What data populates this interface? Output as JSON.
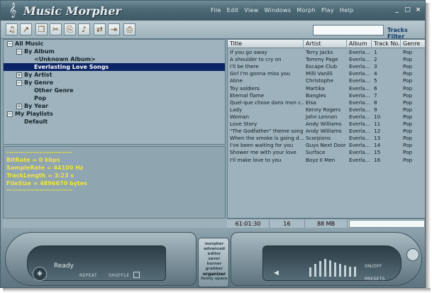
{
  "window": {
    "title": "Music Morpher",
    "logo_glyph": "𝄞",
    "controls": [
      "_",
      "□",
      "×"
    ]
  },
  "menu": [
    "File",
    "Edit",
    "View",
    "Windows",
    "Morph",
    "Play",
    "Help"
  ],
  "toolbar": {
    "buttons": [
      "add-music-icon",
      "add-folder-icon",
      "copy-icon",
      "cut-icon",
      "paste-icon",
      "music-note-icon",
      "move-icon",
      "export-icon",
      "print-icon"
    ],
    "filter_label": "Tracks Filter",
    "filter_value": ""
  },
  "tree": {
    "all_music": "All Music",
    "by_album": "By Album",
    "unknown_album": "<Unknown Album>",
    "everlasting": "Everlasting Love Songs",
    "by_artist": "By Artist",
    "by_genre": "By Genre",
    "other_genre": "Other Genre",
    "pop": "Pop",
    "by_year": "By Year",
    "my_playlists": "My Playlists",
    "default": "Default",
    "expanded_glyph": "−",
    "collapsed_glyph": "+"
  },
  "info": {
    "separator": "----------------------------",
    "bitrate": "BitRate = 0 kbps",
    "samplerate": "SampleRate = 44100 Hz",
    "tracklength": "TrackLength = 3:23 s",
    "filesize": "FileSize = 4896670 bytes"
  },
  "table": {
    "columns": [
      "Title",
      "Artist",
      "Album",
      "Track No.",
      "Genre"
    ],
    "rows": [
      [
        "If you go away",
        "Terry Jacks",
        "Everla...",
        "1",
        "Pop"
      ],
      [
        "A shoulder to cry on",
        "Tommy Page",
        "Everla...",
        "2",
        "Pop"
      ],
      [
        "I'll be there",
        "Escape Club",
        "Everla...",
        "3",
        "Pop"
      ],
      [
        "Girl I'm gonna miss you",
        "Milli Vanilli",
        "Everla...",
        "4",
        "Pop"
      ],
      [
        "Aline",
        "Christophe",
        "Everla...",
        "5",
        "Pop"
      ],
      [
        "Toy soldiers",
        "Martika",
        "Everla...",
        "6",
        "Pop"
      ],
      [
        "Eternal flame",
        "Bangles",
        "Everla...",
        "7",
        "Pop"
      ],
      [
        "Quel-que chose dans mon c...",
        "Elsa",
        "Everla...",
        "8",
        "Pop"
      ],
      [
        "Lady",
        "Kenny Rogers",
        "Everla...",
        "9",
        "Pop"
      ],
      [
        "Woman",
        "John Lennon",
        "Everla...",
        "10",
        "Pop"
      ],
      [
        "Love Story",
        "Andy Williams",
        "Everla...",
        "11",
        "Pop"
      ],
      [
        "\"The Godfather\" theme song",
        "Andy Williams",
        "Everla...",
        "12",
        "Pop"
      ],
      [
        "When the smoke is going d...",
        "Scorpions",
        "Everla...",
        "13",
        "Pop"
      ],
      [
        "I've been waiting for you",
        "Guys Next Door",
        "Everla...",
        "14",
        "Pop"
      ],
      [
        "Shower me with your love",
        "Surface",
        "Everla...",
        "15",
        "Pop"
      ],
      [
        "I'll make love to you",
        "Boyz II Men",
        "Everla...",
        "16",
        "Pop"
      ]
    ]
  },
  "status": {
    "duration": "61:01:30",
    "count": "16",
    "size": "88 MB"
  },
  "player": {
    "status": "Ready",
    "repeat": "REPEAT",
    "shuffle": "SHUFFLE",
    "modes": [
      "morpher",
      "advanced",
      "editor",
      "saver",
      "burner",
      "grabber",
      "organizer",
      "funny space"
    ],
    "active_mode": "organizer",
    "on_off": "ON/OFF",
    "presets": "PRESETS",
    "eq_levels": [
      0.35,
      0.5,
      0.6,
      0.7,
      0.65,
      0.55,
      0.5,
      0.45,
      0.4,
      0.4
    ]
  }
}
